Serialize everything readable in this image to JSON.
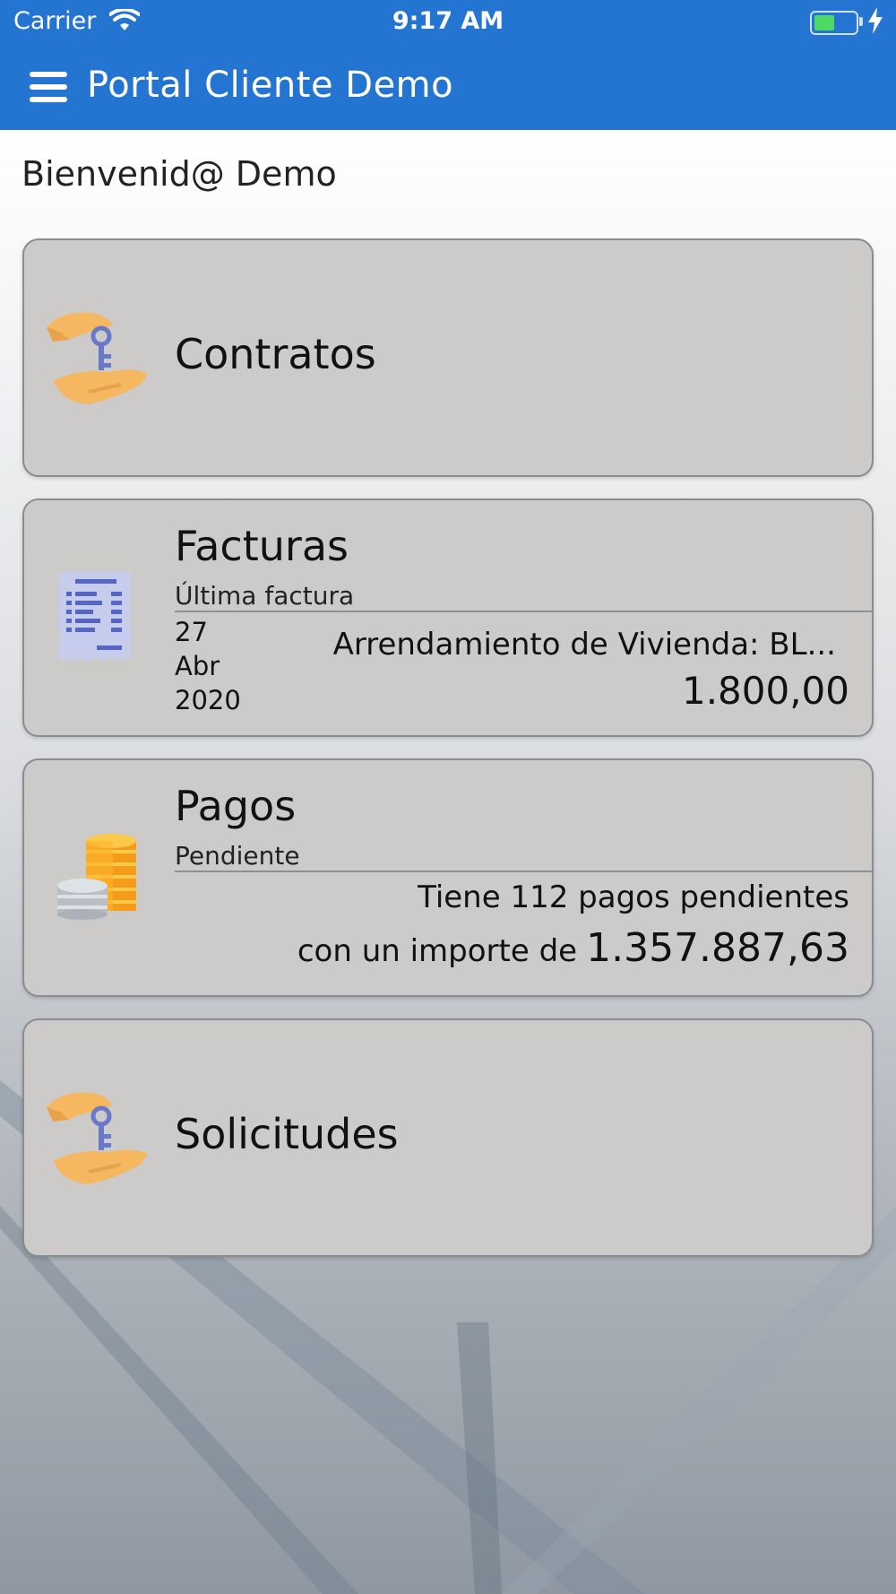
{
  "status_bar": {
    "carrier": "Carrier",
    "time": "9:17 AM"
  },
  "app_bar": {
    "title": "Portal Cliente Demo"
  },
  "welcome": "Bienvenid@ Demo",
  "cards": {
    "contratos": {
      "title": "Contratos",
      "icon": "hand-key-icon"
    },
    "facturas": {
      "title": "Facturas",
      "subtitle": "Última factura",
      "day": "27",
      "month": "Abr",
      "year": "2020",
      "description": "Arrendamiento de Vivienda: BL...",
      "amount": "1.800,00",
      "icon": "invoice-icon"
    },
    "pagos": {
      "title": "Pagos",
      "subtitle": "Pendiente",
      "line1": "Tiene 112 pagos pendientes",
      "line2_prefix": "con un importe de",
      "amount": "1.357.887,63",
      "icon": "coins-icon"
    },
    "solicitudes": {
      "title": "Solicitudes",
      "icon": "hand-key-icon"
    }
  },
  "colors": {
    "app_bar": "#2474d1",
    "card": "#cccbca",
    "battery": "#4cd964"
  }
}
